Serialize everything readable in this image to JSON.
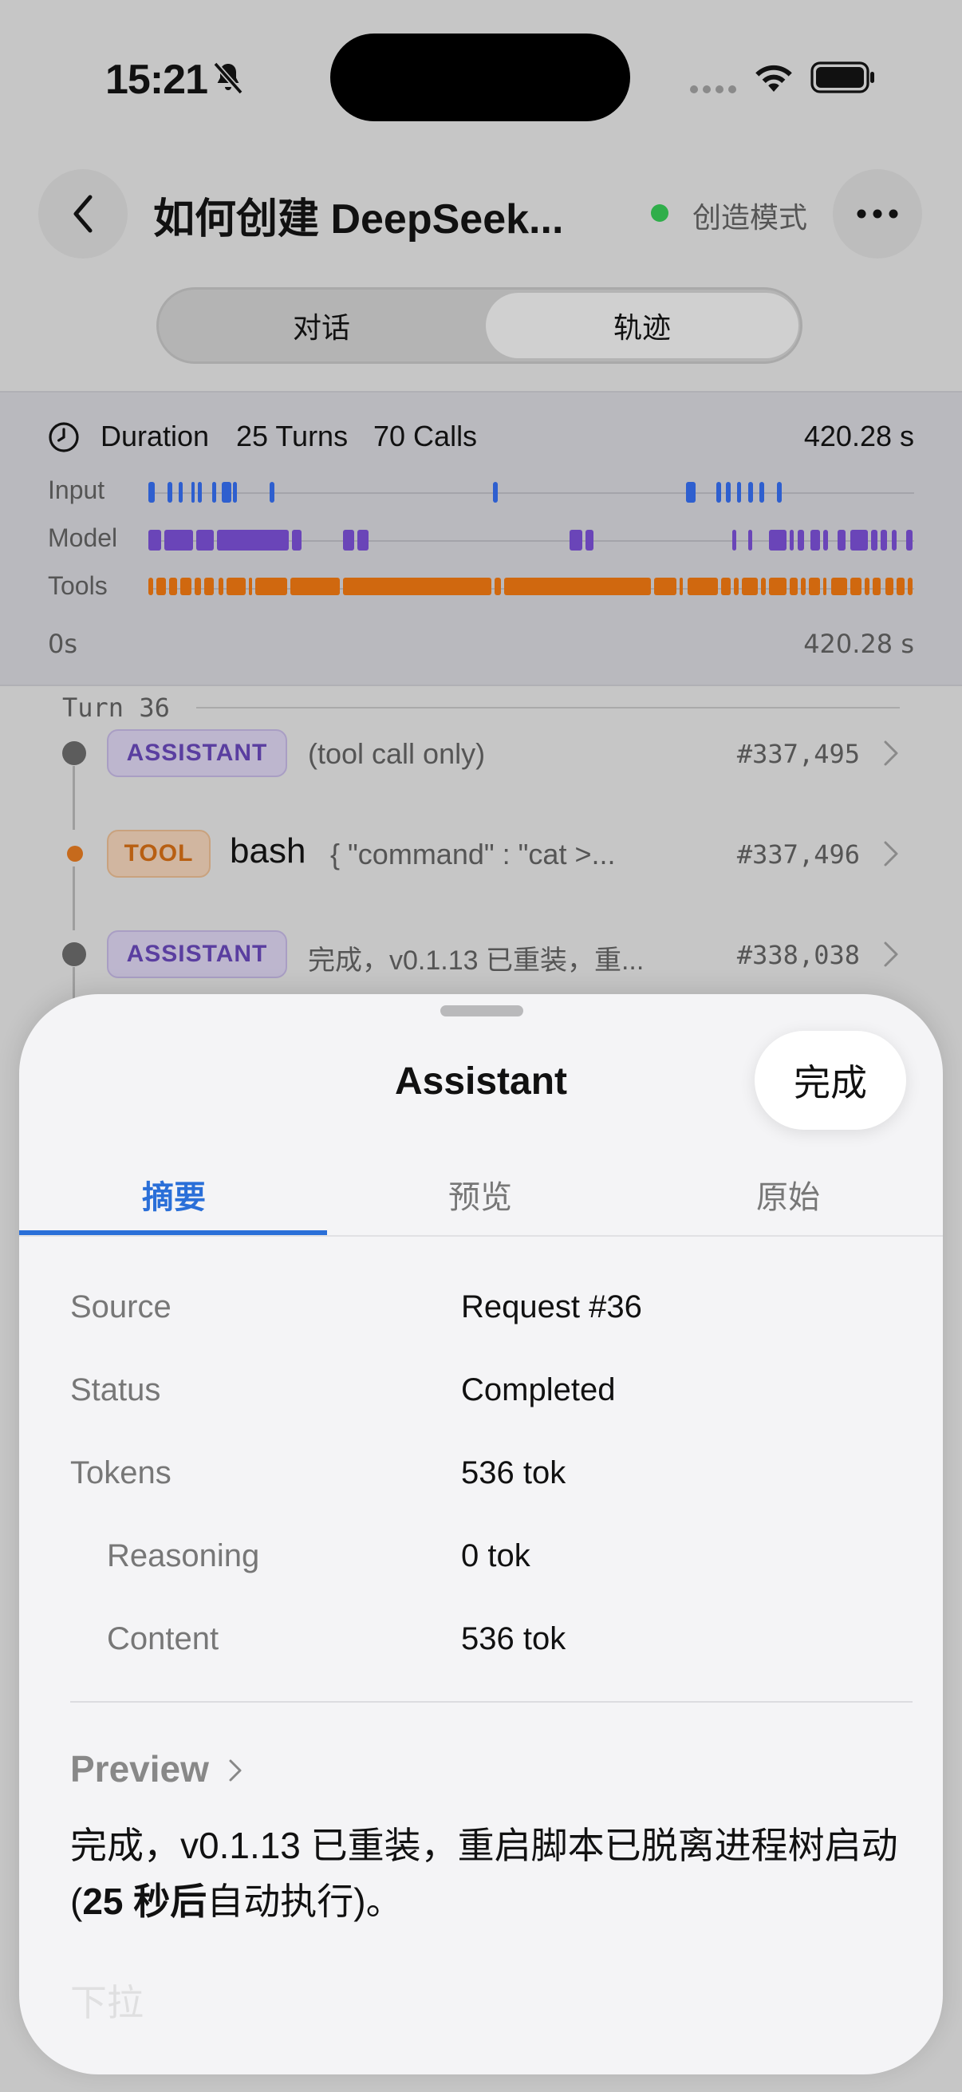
{
  "status_bar": {
    "time": "15:21"
  },
  "header": {
    "title": "如何创建 DeepSeek...",
    "mode_label": "创造模式",
    "mode_color": "#2fae4a"
  },
  "segmented": {
    "left": "对话",
    "right": "轨迹",
    "selected": "轨迹"
  },
  "timeline": {
    "label_duration": "Duration",
    "turns": "25 Turns",
    "calls": "70 Calls",
    "total": "420.28 s",
    "lanes": [
      "Input",
      "Model",
      "Tools"
    ],
    "axis_start": "0s",
    "axis_end": "420.28 s",
    "colors": {
      "input": "#2e5fcf",
      "model": "#6a45b8",
      "tools": "#d0680f"
    }
  },
  "turn": {
    "label": "Turn 36",
    "events": [
      {
        "badge": "ASSISTANT",
        "text": "(tool call only)",
        "number": "#337,495"
      },
      {
        "badge": "TOOL",
        "tool_name": "bash",
        "text": "{   \"command\" : \"cat >...",
        "number": "#337,496"
      },
      {
        "badge": "ASSISTANT",
        "text": "完成，v0.1.13 已重装，重...",
        "number": "#338,038"
      }
    ]
  },
  "sheet": {
    "title": "Assistant",
    "done_label": "完成",
    "tabs": [
      "摘要",
      "预览",
      "原始"
    ],
    "active_tab": "摘要",
    "rows": [
      {
        "key": "Source",
        "value": "Request #36"
      },
      {
        "key": "Status",
        "value": "Completed"
      },
      {
        "key": "Tokens",
        "value": "536 tok"
      },
      {
        "key": "Reasoning",
        "value": "0 tok"
      },
      {
        "key": "Content",
        "value": "536 tok"
      }
    ],
    "preview_label": "Preview",
    "preview_text_1": "完成，v0.1.13 已重装，重启脚本已脱离进程树启动 (",
    "preview_text_bold": "25 秒后",
    "preview_text_2": "自动执行)。",
    "fade_text": "下拉"
  }
}
